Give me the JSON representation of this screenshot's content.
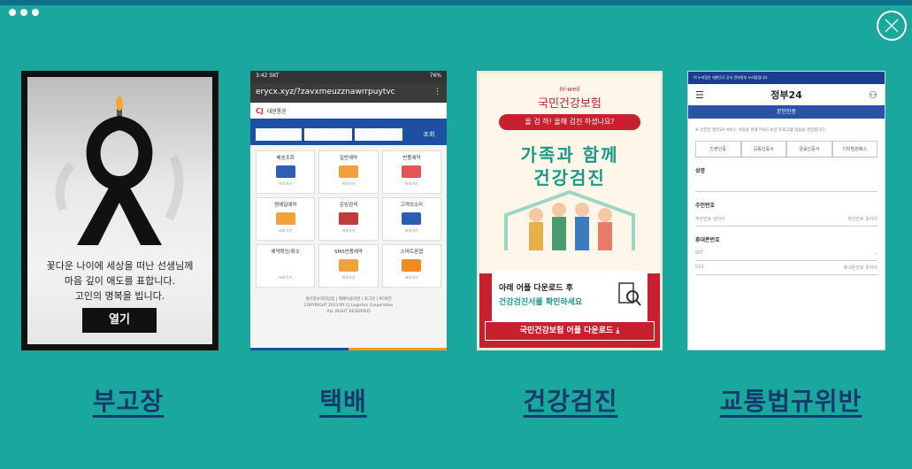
{
  "captions": [
    "부고장",
    "택배",
    "건강검진",
    "교통법규위반"
  ],
  "card_funeral": {
    "message_lines": [
      "꽃다운 나이에 세상을 떠난 선생님께",
      "마음 깊이 애도를 표합니다.",
      "고인의 명복을 빕니다."
    ],
    "button": "열기"
  },
  "card_delivery": {
    "status_time": "3:42 SKT",
    "status_right": "76%",
    "url": "erycx.xyz/?zavxmeuzznawrrpuytvc",
    "logo": "CJ",
    "brand": "대한통운",
    "search_button": "조회",
    "tiles": [
      "배송조회",
      "일반예약",
      "반품예약",
      "원예일예약",
      "운임검색",
      "고객의소리",
      "예약확인/취소",
      "SMS반품예약",
      "스마트폰앱"
    ],
    "tile_sub": "바로가기",
    "footer_links": "개인정보처리방침 | 택배이용약관 | 로그인 | PC버전",
    "copyright": "COPYRIGHT 2013 BY CJ Logistics Corporation",
    "rights": "ALL RIGHT RESERVED"
  },
  "card_health": {
    "brand_small": "hi-well",
    "brand": "국민건강보험",
    "pill": "올 검 하! 올해 검진 하셨나요?",
    "headline1": "가족과 함께",
    "headline2": "건강검진",
    "line1": "아래 어플 다운로드 후",
    "line2": "건강검진서를 확인하세요",
    "download": "국민건강보험 어플 다운로드 ⤓"
  },
  "card_gov": {
    "banner": "이 누리집은 대한민국 공식 전자정부 누리집입니다.",
    "brand": "정부24",
    "nav": "본인인증",
    "notice": "※ 안전한 정부24 서비스 이용을 위해 키보드보안 프로그램 적용을 권장합니다.",
    "tabs": [
      "간편인증",
      "공동인증서",
      "금융인증서",
      "디지털원패스"
    ],
    "name_label": "성명",
    "id_label": "주민번호",
    "id_front": "주민번호 앞자리",
    "id_back": "주민번호 뒷자리",
    "phone_label": "휴대폰번호",
    "carrier": "SKT",
    "prefix": "010",
    "phone_placeholder": "휴대폰번호 뒷자리"
  }
}
